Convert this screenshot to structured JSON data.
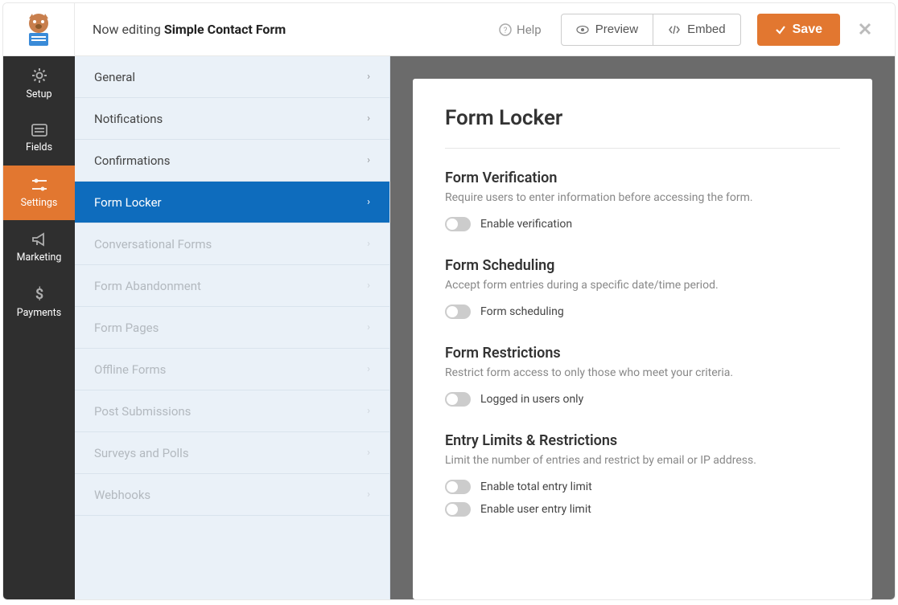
{
  "header": {
    "editing_prefix": "Now editing",
    "form_name": "Simple Contact Form",
    "help": "Help",
    "preview": "Preview",
    "embed": "Embed",
    "save": "Save"
  },
  "nav": {
    "setup": "Setup",
    "fields": "Fields",
    "settings": "Settings",
    "marketing": "Marketing",
    "payments": "Payments"
  },
  "subpanel": {
    "items": [
      {
        "label": "General",
        "state": "normal"
      },
      {
        "label": "Notifications",
        "state": "normal"
      },
      {
        "label": "Confirmations",
        "state": "normal"
      },
      {
        "label": "Form Locker",
        "state": "active"
      },
      {
        "label": "Conversational Forms",
        "state": "muted"
      },
      {
        "label": "Form Abandonment",
        "state": "muted"
      },
      {
        "label": "Form Pages",
        "state": "muted"
      },
      {
        "label": "Offline Forms",
        "state": "muted"
      },
      {
        "label": "Post Submissions",
        "state": "muted"
      },
      {
        "label": "Surveys and Polls",
        "state": "muted"
      },
      {
        "label": "Webhooks",
        "state": "muted"
      }
    ]
  },
  "content": {
    "title": "Form Locker",
    "sections": [
      {
        "heading": "Form Verification",
        "desc": "Require users to enter information before accessing the form.",
        "toggles": [
          "Enable verification"
        ]
      },
      {
        "heading": "Form Scheduling",
        "desc": "Accept form entries during a specific date/time period.",
        "toggles": [
          "Form scheduling"
        ]
      },
      {
        "heading": "Form Restrictions",
        "desc": "Restrict form access to only those who meet your criteria.",
        "toggles": [
          "Logged in users only"
        ]
      },
      {
        "heading": "Entry Limits & Restrictions",
        "desc": "Limit the number of entries and restrict by email or IP address.",
        "toggles": [
          "Enable total entry limit",
          "Enable user entry limit"
        ]
      }
    ]
  }
}
